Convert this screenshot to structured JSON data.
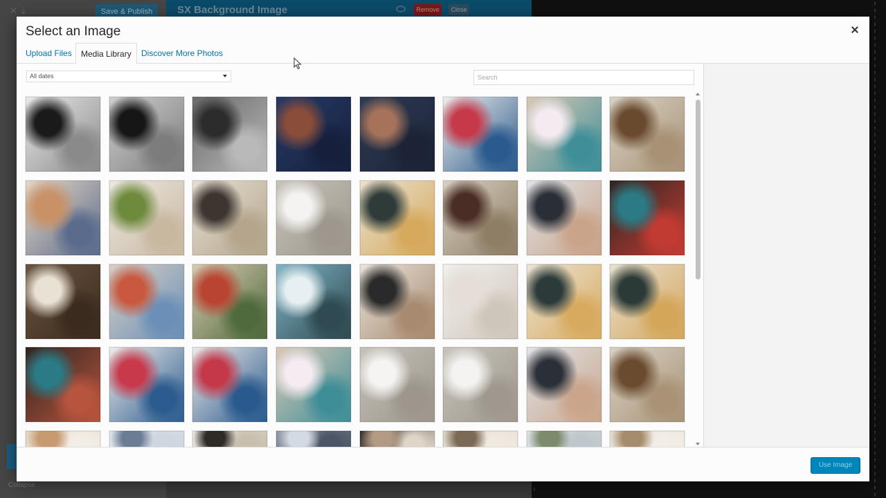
{
  "background": {
    "publish_label": "Save & Publish",
    "panel_title": "SX Background Image",
    "remove_label": "Remove",
    "close_label": "Close",
    "collapse_label": "Collapse"
  },
  "modal": {
    "title": "Select an Image",
    "close_icon": "close-icon",
    "tabs": [
      {
        "label": "Upload Files",
        "active": false
      },
      {
        "label": "Media Library",
        "active": true
      },
      {
        "label": "Discover More Photos",
        "active": false
      }
    ],
    "filter": {
      "selected": "All dates"
    },
    "search": {
      "placeholder": "Search",
      "value": ""
    },
    "footer": {
      "use_label": "Use Image"
    }
  },
  "media": [
    {
      "desc": "bw-crowd-1",
      "colors": [
        "#e9e9e9",
        "#1a1a1a",
        "#8a8a8a"
      ]
    },
    {
      "desc": "bw-crowd-2",
      "colors": [
        "#cfcfcf",
        "#161616",
        "#7c7c7c"
      ]
    },
    {
      "desc": "dark-forest",
      "colors": [
        "#6a6a6a",
        "#2c2c2c",
        "#b9b9b9"
      ]
    },
    {
      "desc": "color-crowd-1",
      "colors": [
        "#263a66",
        "#8a4d3a",
        "#16203d"
      ]
    },
    {
      "desc": "color-crowd-2",
      "colors": [
        "#2e3b55",
        "#a6735a",
        "#1c2336"
      ]
    },
    {
      "desc": "plates-top",
      "colors": [
        "#efedea",
        "#c6394a",
        "#2b5b8e"
      ]
    },
    {
      "desc": "cups-top",
      "colors": [
        "#d7c6b2",
        "#f4eaf0",
        "#3f8f99"
      ]
    },
    {
      "desc": "hotel-room",
      "colors": [
        "#d9d3c6",
        "#6a4a2f",
        "#a89276"
      ]
    },
    {
      "desc": "round-tray",
      "colors": [
        "#e6d7c4",
        "#c99166",
        "#5a6b8c"
      ]
    },
    {
      "desc": "plants-table",
      "colors": [
        "#ece8e2",
        "#6e8a3c",
        "#c8b8a0"
      ]
    },
    {
      "desc": "desk-items",
      "colors": [
        "#e6dfd3",
        "#3c3530",
        "#b4a58c"
      ]
    },
    {
      "desc": "beach-chairs",
      "colors": [
        "#c7c2ba",
        "#f4f3f1",
        "#9d978d"
      ]
    },
    {
      "desc": "bag-hanging",
      "colors": [
        "#e9e1d0",
        "#2e3b38",
        "#d6a95c"
      ]
    },
    {
      "desc": "leather-table",
      "colors": [
        "#d8d0c2",
        "#4a2d24",
        "#8e7e66"
      ]
    },
    {
      "desc": "magazine-hand",
      "colors": [
        "#dfe3e8",
        "#2a2e36",
        "#c9a48a"
      ]
    },
    {
      "desc": "cafe-bar",
      "colors": [
        "#2e2622",
        "#2b7a86",
        "#c23b32"
      ]
    },
    {
      "desc": "woman-wood",
      "colors": [
        "#6a5440",
        "#e9e1d4",
        "#3b2a1e"
      ]
    },
    {
      "desc": "art-supplies",
      "colors": [
        "#d8d0c6",
        "#c8583e",
        "#6b8fb7"
      ]
    },
    {
      "desc": "chess-board",
      "colors": [
        "#d9cbb3",
        "#b94432",
        "#4f6a3c"
      ]
    },
    {
      "desc": "lake-woman",
      "colors": [
        "#7fb3c4",
        "#e6f0f2",
        "#2f4a52"
      ]
    },
    {
      "desc": "stairs-woman",
      "colors": [
        "#e9e4dc",
        "#2a2a2a",
        "#a88a70"
      ]
    },
    {
      "desc": "white-tray",
      "colors": [
        "#f3f1ee",
        "#e4ded6",
        "#cfc6bb"
      ]
    },
    {
      "desc": "bag-hanging-2",
      "colors": [
        "#ebe4d5",
        "#2c3b3a",
        "#d8aa5f"
      ]
    },
    {
      "desc": "bag-hanging-3",
      "colors": [
        "#e8e1d2",
        "#2b3a37",
        "#d4a65a"
      ]
    },
    {
      "desc": "cafe-bar-2",
      "colors": [
        "#2f2520",
        "#2a7b86",
        "#b7543d"
      ]
    },
    {
      "desc": "perfume-plates",
      "colors": [
        "#eeece9",
        "#c7394b",
        "#2c5c8f"
      ]
    },
    {
      "desc": "plates-top-2",
      "colors": [
        "#edebe8",
        "#c4384a",
        "#2a5a8d"
      ]
    },
    {
      "desc": "cups-top-2",
      "colors": [
        "#d9c7b3",
        "#f5ebf1",
        "#3e8e98"
      ]
    },
    {
      "desc": "beach-chairs-2",
      "colors": [
        "#c6c1b9",
        "#f5f4f2",
        "#9c968c"
      ]
    },
    {
      "desc": "beach-chairs-3",
      "colors": [
        "#c8c3bb",
        "#f4f3f1",
        "#9e988e"
      ]
    },
    {
      "desc": "magazine-hand-2",
      "colors": [
        "#e0e4e9",
        "#2b2f37",
        "#caa58b"
      ]
    },
    {
      "desc": "hotel-room-2",
      "colors": [
        "#d8d2c5",
        "#6b4b30",
        "#a99377"
      ]
    },
    {
      "desc": "row5-1",
      "colors": [
        "#e4d6c4",
        "#c89a70",
        "#f2ede6"
      ]
    },
    {
      "desc": "row5-2",
      "colors": [
        "#e2e6ec",
        "#6b7c94",
        "#cfd6df"
      ]
    },
    {
      "desc": "row5-3",
      "colors": [
        "#ece8e2",
        "#2e2a26",
        "#c9bfae"
      ]
    },
    {
      "desc": "row5-4",
      "colors": [
        "#8e97a6",
        "#d4dae3",
        "#4c5566"
      ]
    },
    {
      "desc": "row5-5",
      "colors": [
        "#3a2e2a",
        "#b29a84",
        "#e0d6c8"
      ]
    },
    {
      "desc": "row5-6",
      "colors": [
        "#dad3c6",
        "#7b6a54",
        "#efe9e0"
      ]
    },
    {
      "desc": "row5-7",
      "colors": [
        "#dfe3e6",
        "#7d8b6d",
        "#bfc7cc"
      ]
    },
    {
      "desc": "row5-8",
      "colors": [
        "#e6dfd2",
        "#a58c6c",
        "#f2ede6"
      ]
    }
  ]
}
